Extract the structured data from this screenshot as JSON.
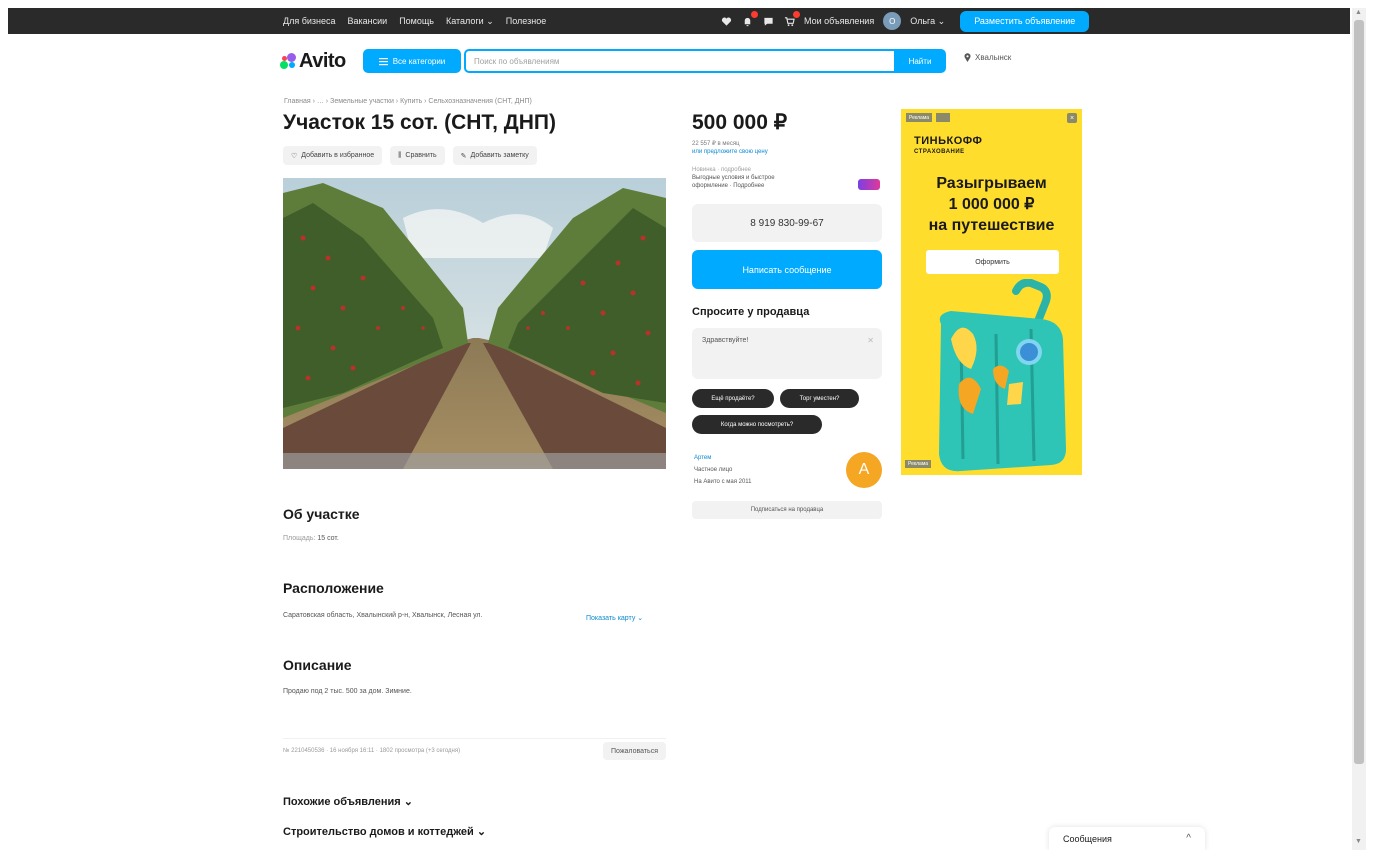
{
  "topbar": {
    "links": [
      "Для бизнеса",
      "Вакансии",
      "Помощь",
      "Каталоги",
      "Полезное"
    ],
    "my_ads": "Мои объявления",
    "avatar_letter": "О",
    "user_name": "Ольга",
    "post_button": "Разместить объявление"
  },
  "header": {
    "logo_text": "Avito",
    "categories_button": "Все категории",
    "search_placeholder": "Поиск по объявлениям",
    "search_button": "Найти",
    "city": "Хвалынск"
  },
  "listing": {
    "breadcrumb": "Главная › … › Земельные участки › Купить › Сельхозназначения (СНТ, ДНП)",
    "title": "Участок 15 сот. (СНТ, ДНП)",
    "actions": {
      "favorite": "Добавить в избранное",
      "compare": "Сравнить",
      "note": "Добавить заметку"
    },
    "about_title": "Об участке",
    "area_label": "Площадь:",
    "area_value": "15 сот.",
    "location_title": "Расположение",
    "address": "Саратовская область, Хвалынский р-н, Хвалынск, Лесная ул.",
    "map_link": "Показать карту",
    "description_title": "Описание",
    "description_text": "Продаю под 2 тыс. 500 за дом. Зимние.",
    "meta": "№ 2210450536 · 16 ноября 16:11 · 1802 просмотра (+3 сегодня)",
    "report_button": "Пожаловаться",
    "similar_title": "Похожие объявления",
    "construction_title": "Строительство домов и коттеджей"
  },
  "sidebar": {
    "price": "500 000 ₽",
    "credit_line1": "22 557 ₽ в месяц",
    "credit_line2": "или предложите свою цену",
    "promo_line1": "Новинка · подробнее",
    "promo_line2": "Выгодные условия и быстрое",
    "promo_line3": "оформление · Подробнее",
    "phone": "8 919 830-99-67",
    "message_button": "Написать сообщение",
    "ask_title": "Спросите у продавца",
    "ask_placeholder": "Здравствуйте!",
    "chips": [
      "Ещё продаёте?",
      "Торг уместен?",
      "Когда можно посмотреть?"
    ],
    "seller_name": "Артем",
    "seller_type": "Частное лицо",
    "seller_since": "На Авито с мая 2011",
    "seller_initial": "А",
    "subscribe_button": "Подписаться на продавца"
  },
  "ad": {
    "label": "Реклама",
    "close": "×",
    "brand_line1": "ТИНЬКОФФ",
    "brand_line2": "СТРАХОВАНИЕ",
    "headline_line1": "Разыгрываем",
    "headline_line2": "1 000 000 ₽",
    "headline_line3": "на путешествие",
    "cta": "Оформить",
    "footer": "Реклама"
  },
  "messages_widget": {
    "label": "Сообщения",
    "chevron": "^"
  },
  "colors": {
    "accent": "#00aaff",
    "topbar": "#2a2a2a",
    "ad_bg": "#ffdd2d",
    "avatar": "#f5a623"
  }
}
